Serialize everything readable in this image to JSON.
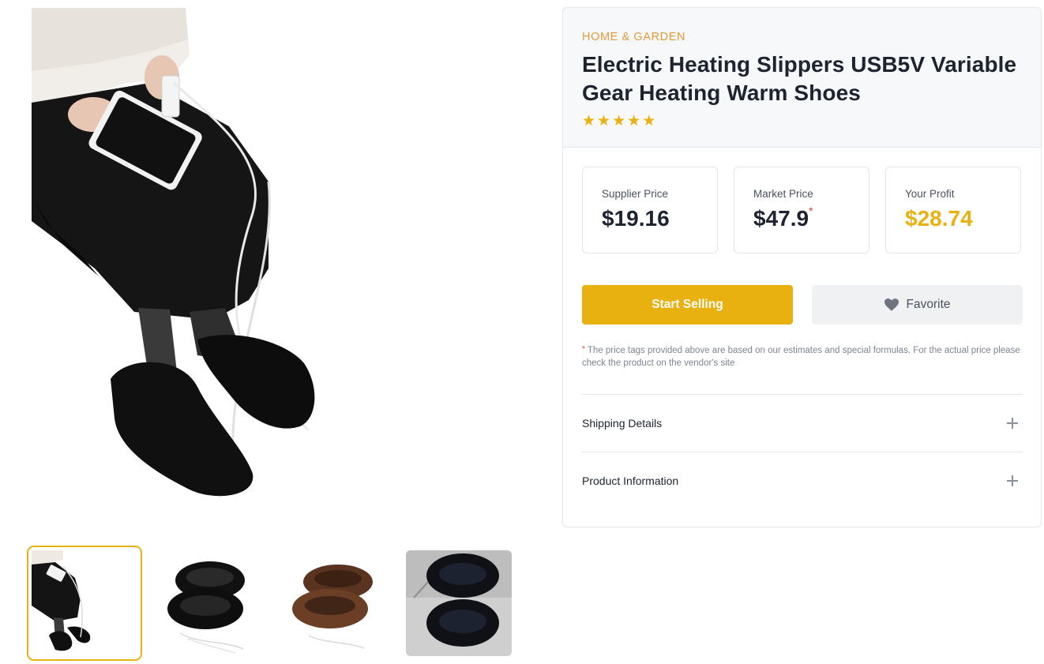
{
  "product": {
    "category": "HOME & GARDEN",
    "title": "Electric Heating Slippers USB5V Variable Gear Heating Warm Shoes",
    "rating": 5,
    "rating_max": 5
  },
  "gallery": {
    "main_image": "woman-wearing-heated-slippers-with-power-bank",
    "thumbnails": [
      {
        "name": "thumbnail-woman-wearing-slippers",
        "selected": true
      },
      {
        "name": "thumbnail-black-slippers",
        "selected": false
      },
      {
        "name": "thumbnail-brown-slippers",
        "selected": false
      },
      {
        "name": "thumbnail-black-slippers-top-view",
        "selected": false
      }
    ]
  },
  "prices": {
    "supplier_label": "Supplier Price",
    "supplier_value": "$19.16",
    "market_label": "Market Price",
    "market_value": "$47.9",
    "market_asterisk": "*",
    "profit_label": "Your Profit",
    "profit_value": "$28.74"
  },
  "actions": {
    "start_selling": "Start Selling",
    "favorite": "Favorite"
  },
  "disclaimer": {
    "asterisk": "*",
    "text": " The price tags provided above are based on our estimates and special formulas. For the actual price please check the product on the vendor's site"
  },
  "accordion": {
    "shipping": "Shipping Details",
    "product_info": "Product Information"
  },
  "colors": {
    "accent": "#e8b10f",
    "category": "#e39b3a",
    "asterisk": "#e03b3b",
    "selected_thumb_border": "#e6b21a"
  },
  "icons": {
    "star": "star-icon",
    "heart": "heart-icon",
    "expand": "plus-icon"
  }
}
